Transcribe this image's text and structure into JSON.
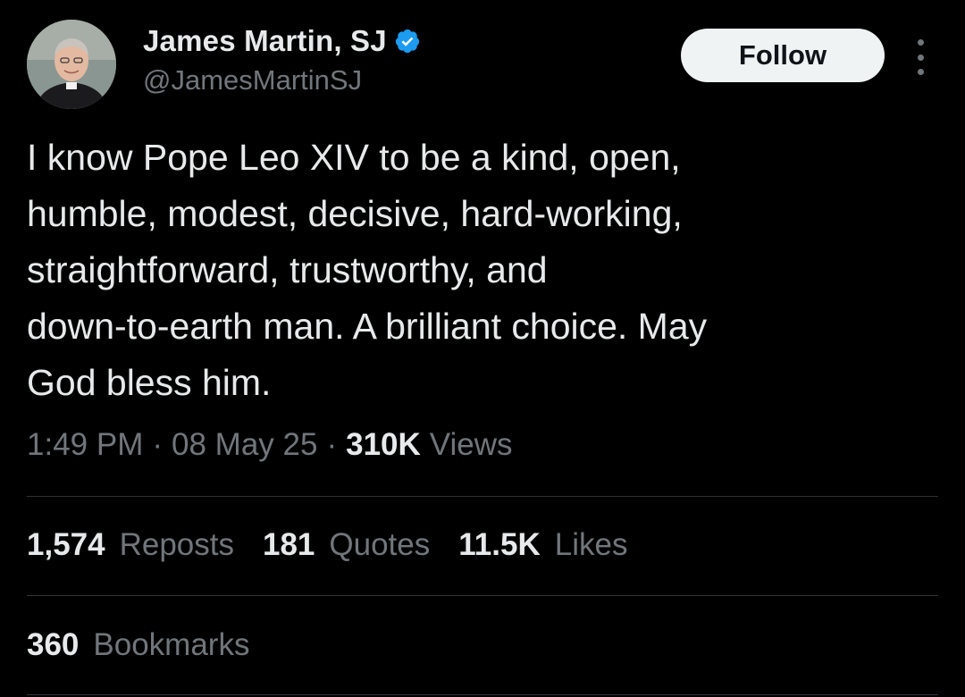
{
  "author": {
    "display_name": "James Martin, SJ",
    "handle": "@JamesMartinSJ",
    "verified": true,
    "avatar_icon": "profile-photo"
  },
  "actions": {
    "follow_label": "Follow",
    "more_icon": "more-vertical-icon"
  },
  "tweet": {
    "text": "I know Pope Leo XIV to be a kind, open,\nhumble, modest, decisive, hard-working,\nstraightforward, trustworthy, and\ndown-to-earth man. A brilliant choice. May\nGod bless him."
  },
  "meta": {
    "time": "1:49 PM",
    "separator": "·",
    "date": "08 May 25",
    "views_count": "310K",
    "views_label": "Views"
  },
  "stats": {
    "reposts": {
      "count": "1,574",
      "label": "Reposts"
    },
    "quotes": {
      "count": "181",
      "label": "Quotes"
    },
    "likes": {
      "count": "11.5K",
      "label": "Likes"
    },
    "bookmarks": {
      "count": "360",
      "label": "Bookmarks"
    }
  },
  "colors": {
    "background": "#000000",
    "text_primary": "#e7e9ea",
    "text_secondary": "#71767b",
    "verified_badge": "#1d9bf0",
    "divider": "#2f3336",
    "follow_button_bg": "#eff3f4"
  }
}
